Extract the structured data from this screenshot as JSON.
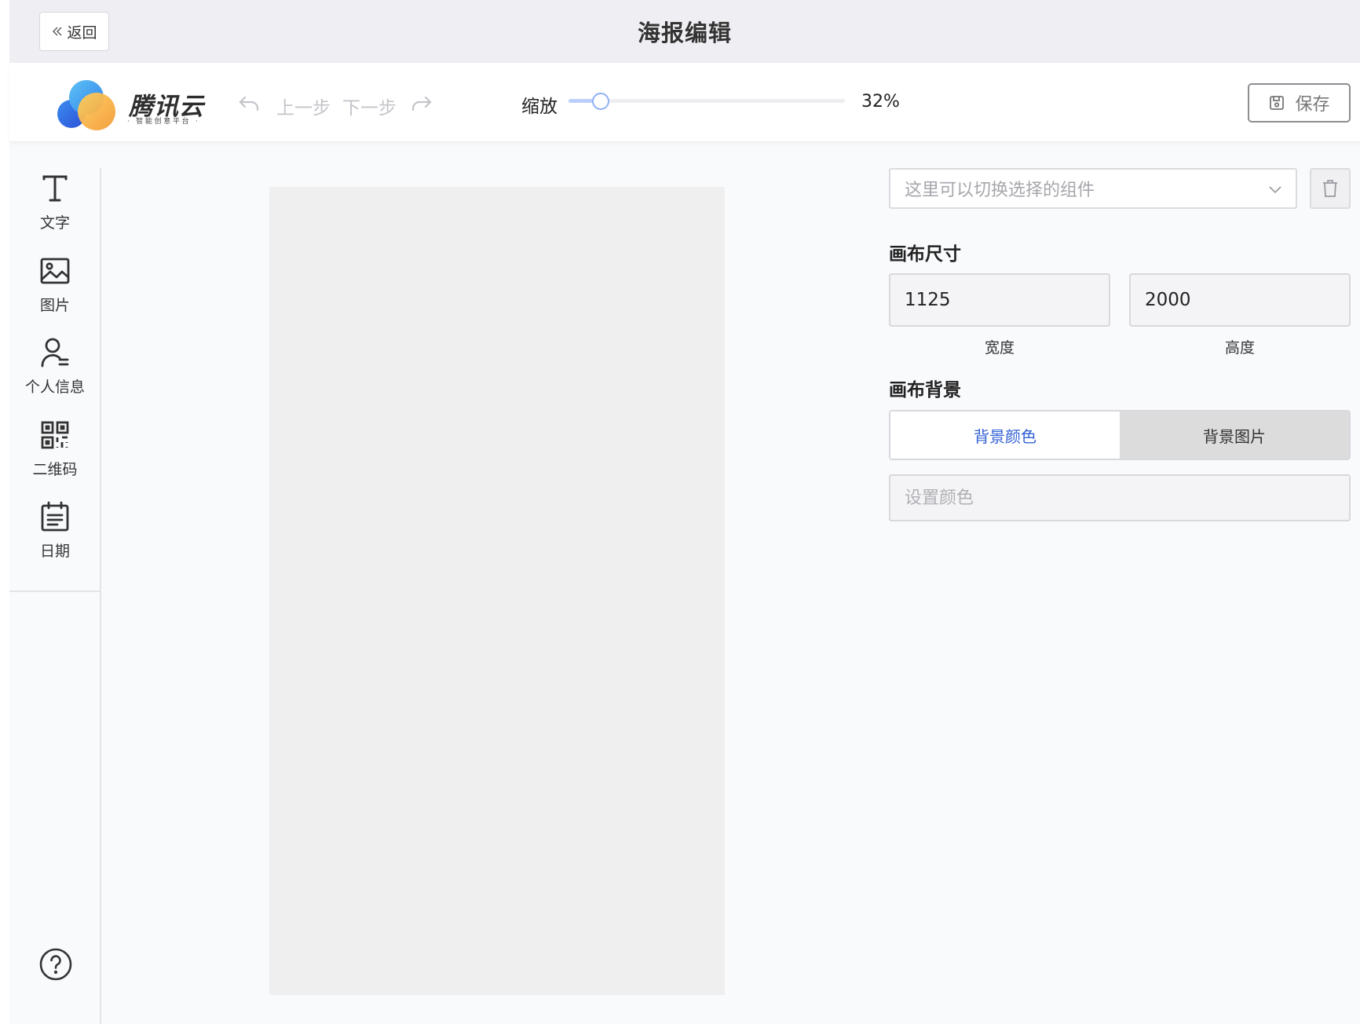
{
  "header": {
    "back_label": "返回",
    "title": "海报编辑"
  },
  "toolbar": {
    "logo_text": "腾讯云",
    "logo_subtitle": "· 智能创意平台 ·",
    "undo_label": "上一步",
    "redo_label": "下一步",
    "zoom_label": "缩放",
    "zoom_percent": 32,
    "zoom_value": "32%",
    "save_label": "保存"
  },
  "tools": [
    {
      "label": "文字",
      "icon": "text-icon"
    },
    {
      "label": "图片",
      "icon": "image-icon"
    },
    {
      "label": "个人信息",
      "icon": "user-info-icon"
    },
    {
      "label": "二维码",
      "icon": "qrcode-icon"
    },
    {
      "label": "日期",
      "icon": "calendar-icon"
    }
  ],
  "help_icon": "help-icon",
  "right_panel": {
    "component_select_placeholder": "这里可以切换选择的组件",
    "canvas_size_label": "画布尺寸",
    "width_value": "1125",
    "height_value": "2000",
    "width_caption": "宽度",
    "height_caption": "高度",
    "canvas_bg_label": "画布背景",
    "bg_tabs": [
      "背景颜色",
      "背景图片"
    ],
    "active_bg_tab": "背景颜色",
    "color_placeholder": "设置颜色"
  },
  "colors": {
    "accent": "#3260d6",
    "canvas": "#efefef",
    "titlebar": "#efeff3"
  }
}
